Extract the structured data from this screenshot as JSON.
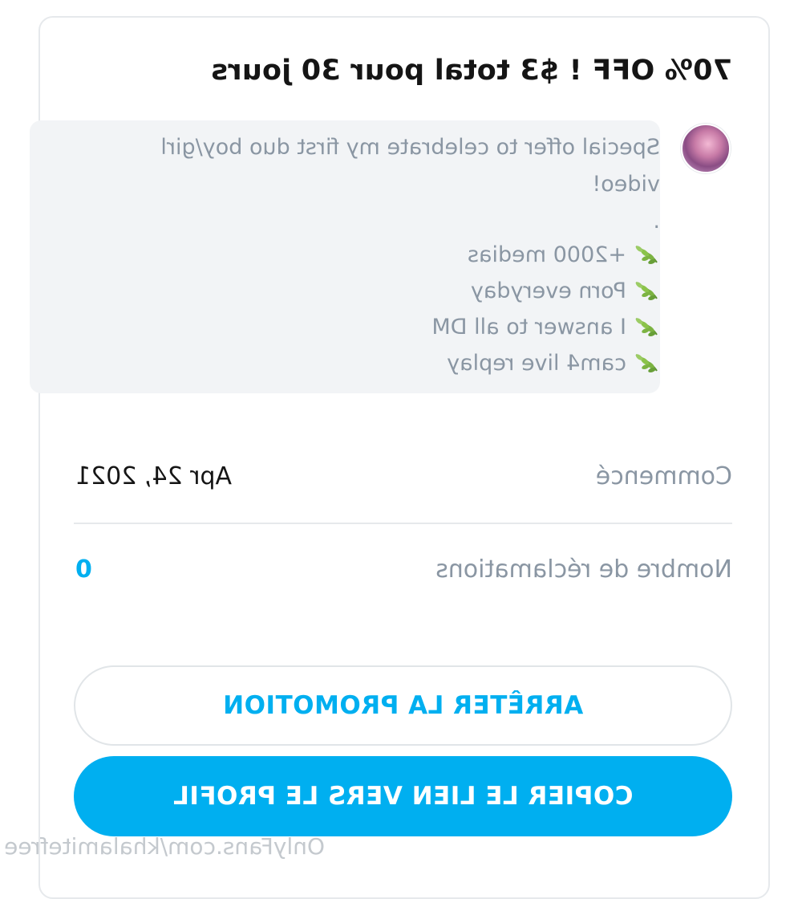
{
  "promo": {
    "title": "70% OFF ! $3 total pour 30 jours",
    "message": {
      "intro_line1": "Special offer to celebrate my first duo boy/girl",
      "intro_line2": "video!",
      "separator": ".",
      "bullets": [
        "+2000 medias",
        "Porn everyday",
        "I answer to all DM",
        "cam4 live replay"
      ],
      "bullet_icon": "herb-icon"
    },
    "started_label": "Commencé",
    "started_value": "Apr 24, 2021",
    "claims_label": "Nombre de réclamations",
    "claims_value": "0"
  },
  "actions": {
    "stop_label": "ARRÊTER LA PROMOTION",
    "copy_label": "COPIER LE LIEN VERS LE PROFIL"
  },
  "watermark": "OnlyFans.com/khalamitefree",
  "colors": {
    "accent": "#00aff0",
    "muted_text": "#8a96a3",
    "panel_bg": "#f2f4f6",
    "border": "#e6e9ec"
  }
}
